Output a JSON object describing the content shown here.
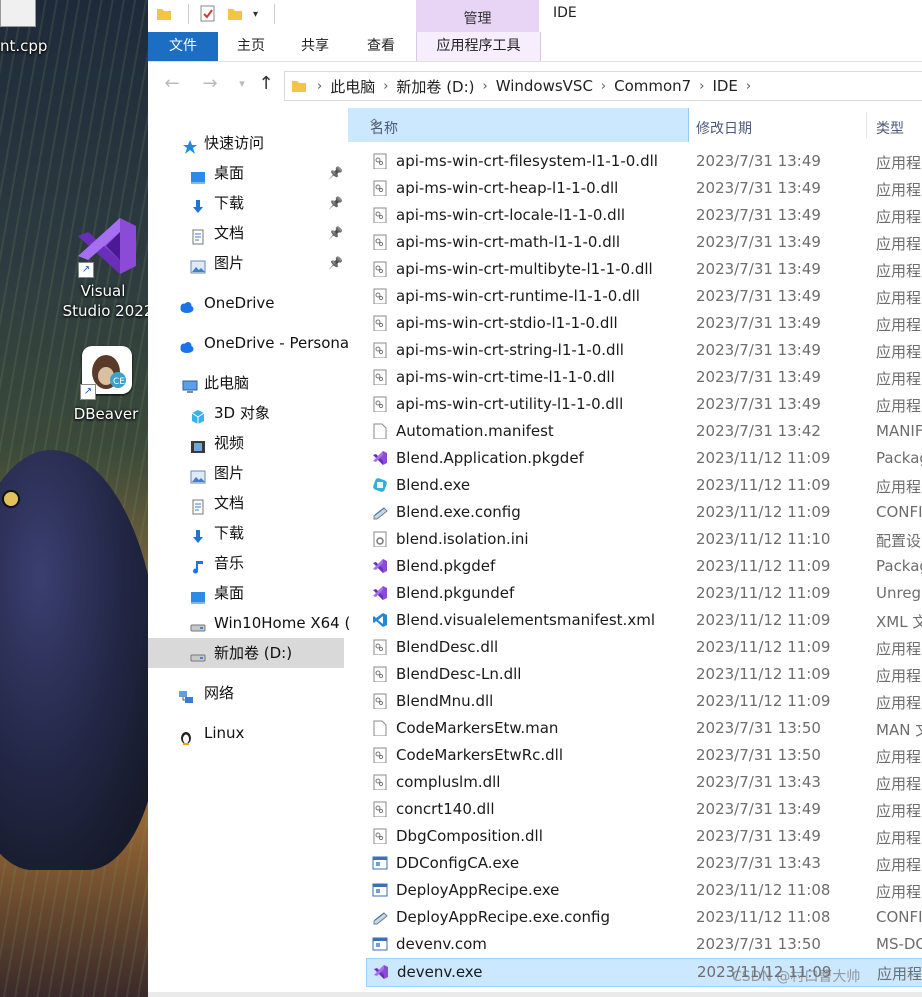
{
  "desktop": {
    "file_label": "nt.cpp",
    "shortcut_vs_line1": "Visual",
    "shortcut_vs_line2": "Studio 2022",
    "shortcut_dbeaver": "DBeaver"
  },
  "titlebar": {
    "context_tab": "管理",
    "window_title": "IDE"
  },
  "ribbon": {
    "tabs": [
      "文件",
      "主页",
      "共享",
      "查看",
      "应用程序工具"
    ]
  },
  "address": {
    "crumbs": [
      "此电脑",
      "新加卷 (D:)",
      "WindowsVSC",
      "Common7",
      "IDE"
    ]
  },
  "sidebar": {
    "items": [
      {
        "label": "快速访问",
        "icon": "star-icon"
      },
      {
        "label": "桌面",
        "icon": "desktop-folder-icon",
        "pinned": true
      },
      {
        "label": "下载",
        "icon": "download-arrow-icon",
        "pinned": true
      },
      {
        "label": "文档",
        "icon": "document-icon",
        "pinned": true
      },
      {
        "label": "图片",
        "icon": "pictures-icon",
        "pinned": true
      },
      {
        "label": "OneDrive",
        "icon": "cloud-icon"
      },
      {
        "label": "OneDrive - Persona",
        "icon": "cloud-icon"
      },
      {
        "label": "此电脑",
        "icon": "computer-icon"
      },
      {
        "label": "3D 对象",
        "icon": "cube-icon"
      },
      {
        "label": "视频",
        "icon": "video-icon"
      },
      {
        "label": "图片",
        "icon": "pictures-icon"
      },
      {
        "label": "文档",
        "icon": "document-icon"
      },
      {
        "label": "下载",
        "icon": "download-arrow-icon"
      },
      {
        "label": "音乐",
        "icon": "music-note-icon"
      },
      {
        "label": "桌面",
        "icon": "desktop-folder-icon"
      },
      {
        "label": "Win10Home X64 (",
        "icon": "drive-icon"
      },
      {
        "label": "新加卷 (D:)",
        "icon": "drive-icon",
        "selected": true
      },
      {
        "label": "网络",
        "icon": "network-icon"
      },
      {
        "label": "Linux",
        "icon": "penguin-icon"
      }
    ]
  },
  "columns": {
    "name": "名称",
    "date": "修改日期",
    "type": "类型"
  },
  "files": [
    {
      "name": "api-ms-win-crt-filesystem-l1-1-0.dll",
      "date": "2023/7/31 13:49",
      "type": "应用程",
      "icon": "dll-icon"
    },
    {
      "name": "api-ms-win-crt-heap-l1-1-0.dll",
      "date": "2023/7/31 13:49",
      "type": "应用程",
      "icon": "dll-icon"
    },
    {
      "name": "api-ms-win-crt-locale-l1-1-0.dll",
      "date": "2023/7/31 13:49",
      "type": "应用程",
      "icon": "dll-icon"
    },
    {
      "name": "api-ms-win-crt-math-l1-1-0.dll",
      "date": "2023/7/31 13:49",
      "type": "应用程",
      "icon": "dll-icon"
    },
    {
      "name": "api-ms-win-crt-multibyte-l1-1-0.dll",
      "date": "2023/7/31 13:49",
      "type": "应用程",
      "icon": "dll-icon"
    },
    {
      "name": "api-ms-win-crt-runtime-l1-1-0.dll",
      "date": "2023/7/31 13:49",
      "type": "应用程",
      "icon": "dll-icon"
    },
    {
      "name": "api-ms-win-crt-stdio-l1-1-0.dll",
      "date": "2023/7/31 13:49",
      "type": "应用程",
      "icon": "dll-icon"
    },
    {
      "name": "api-ms-win-crt-string-l1-1-0.dll",
      "date": "2023/7/31 13:49",
      "type": "应用程",
      "icon": "dll-icon"
    },
    {
      "name": "api-ms-win-crt-time-l1-1-0.dll",
      "date": "2023/7/31 13:49",
      "type": "应用程",
      "icon": "dll-icon"
    },
    {
      "name": "api-ms-win-crt-utility-l1-1-0.dll",
      "date": "2023/7/31 13:49",
      "type": "应用程",
      "icon": "dll-icon"
    },
    {
      "name": "Automation.manifest",
      "date": "2023/7/31 13:42",
      "type": "MANIF",
      "icon": "blank-file-icon"
    },
    {
      "name": "Blend.Application.pkgdef",
      "date": "2023/11/12 11:09",
      "type": "Packag",
      "icon": "visual-studio-icon"
    },
    {
      "name": "Blend.exe",
      "date": "2023/11/12 11:09",
      "type": "应用程",
      "icon": "blend-app-icon"
    },
    {
      "name": "Blend.exe.config",
      "date": "2023/11/12 11:09",
      "type": "CONFI",
      "icon": "config-file-icon"
    },
    {
      "name": "blend.isolation.ini",
      "date": "2023/11/12 11:10",
      "type": "配置设",
      "icon": "ini-file-icon"
    },
    {
      "name": "Blend.pkgdef",
      "date": "2023/11/12 11:09",
      "type": "Packag",
      "icon": "visual-studio-icon"
    },
    {
      "name": "Blend.pkgundef",
      "date": "2023/11/12 11:09",
      "type": "Unreg",
      "icon": "visual-studio-icon"
    },
    {
      "name": "Blend.visualelementsmanifest.xml",
      "date": "2023/11/12 11:09",
      "type": "XML 文",
      "icon": "vscode-icon"
    },
    {
      "name": "BlendDesc.dll",
      "date": "2023/11/12 11:09",
      "type": "应用程",
      "icon": "dll-icon"
    },
    {
      "name": "BlendDesc-Ln.dll",
      "date": "2023/11/12 11:09",
      "type": "应用程",
      "icon": "dll-icon"
    },
    {
      "name": "BlendMnu.dll",
      "date": "2023/11/12 11:09",
      "type": "应用程",
      "icon": "dll-icon"
    },
    {
      "name": "CodeMarkersEtw.man",
      "date": "2023/7/31 13:50",
      "type": "MAN 文",
      "icon": "blank-file-icon"
    },
    {
      "name": "CodeMarkersEtwRc.dll",
      "date": "2023/7/31 13:50",
      "type": "应用程",
      "icon": "dll-icon"
    },
    {
      "name": "compluslm.dll",
      "date": "2023/7/31 13:43",
      "type": "应用程",
      "icon": "dll-icon"
    },
    {
      "name": "concrt140.dll",
      "date": "2023/7/31 13:49",
      "type": "应用程",
      "icon": "dll-icon"
    },
    {
      "name": "DbgComposition.dll",
      "date": "2023/7/31 13:49",
      "type": "应用程",
      "icon": "dll-icon"
    },
    {
      "name": "DDConfigCA.exe",
      "date": "2023/7/31 13:43",
      "type": "应用程",
      "icon": "exe-window-icon"
    },
    {
      "name": "DeployAppRecipe.exe",
      "date": "2023/11/12 11:08",
      "type": "应用程",
      "icon": "exe-window-icon"
    },
    {
      "name": "DeployAppRecipe.exe.config",
      "date": "2023/11/12 11:08",
      "type": "CONFI",
      "icon": "config-file-icon"
    },
    {
      "name": "devenv.com",
      "date": "2023/7/31 13:50",
      "type": "MS-DC",
      "icon": "exe-window-icon"
    },
    {
      "name": "devenv.exe",
      "date": "2023/11/12 11:09",
      "type": "应用程",
      "icon": "visual-studio-icon",
      "selected": true
    }
  ],
  "watermark": "CSDN @村口曹大帅"
}
